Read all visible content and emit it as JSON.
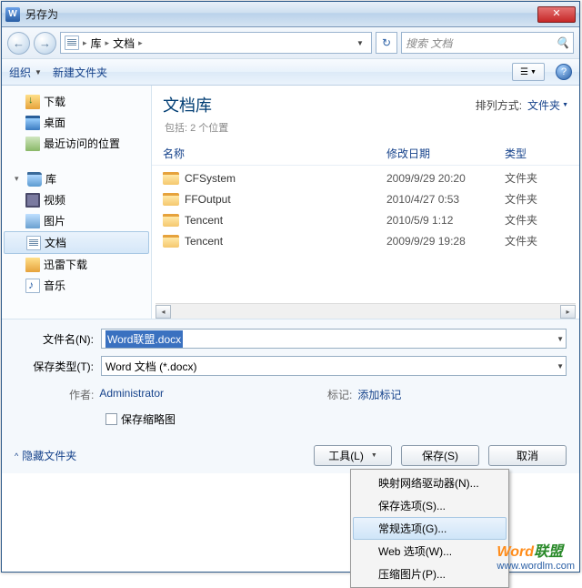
{
  "window": {
    "title": "另存为",
    "close": "✕"
  },
  "nav": {
    "back": "←",
    "forward": "→",
    "crumbs": [
      "库",
      "文档"
    ],
    "refresh": "↻",
    "search_placeholder": "搜索 文档"
  },
  "toolbar": {
    "organize": "组织",
    "newfolder": "新建文件夹",
    "help": "?"
  },
  "sidebar": {
    "items": [
      {
        "label": "下载",
        "icon": "ic-dl"
      },
      {
        "label": "桌面",
        "icon": "ic-desktop"
      },
      {
        "label": "最近访问的位置",
        "icon": "ic-recent"
      }
    ],
    "lib_header": "库",
    "lib_items": [
      {
        "label": "视频",
        "icon": "ic-video"
      },
      {
        "label": "图片",
        "icon": "ic-pic"
      },
      {
        "label": "文档",
        "icon": "ic-doc",
        "selected": true
      },
      {
        "label": "迅雷下载",
        "icon": "ic-thunder"
      },
      {
        "label": "音乐",
        "icon": "ic-music"
      }
    ]
  },
  "main": {
    "lib_title": "文档库",
    "lib_sub": "包括: 2 个位置",
    "arrange_label": "排列方式:",
    "arrange_value": "文件夹",
    "cols": {
      "name": "名称",
      "date": "修改日期",
      "type": "类型"
    },
    "rows": [
      {
        "name": "CFSystem",
        "date": "2009/9/29 20:20",
        "type": "文件夹"
      },
      {
        "name": "FFOutput",
        "date": "2010/4/27 0:53",
        "type": "文件夹"
      },
      {
        "name": "Tencent",
        "date": "2010/5/9 1:12",
        "type": "文件夹"
      },
      {
        "name": "Tencent",
        "date": "2009/9/29 19:28",
        "type": "文件夹"
      }
    ]
  },
  "form": {
    "filename_label": "文件名(N):",
    "filename_value": "Word联盟.docx",
    "savetype_label": "保存类型(T):",
    "savetype_value": "Word 文档 (*.docx)",
    "author_label": "作者:",
    "author_value": "Administrator",
    "tags_label": "标记:",
    "tags_value": "添加标记",
    "thumb_label": "保存缩略图"
  },
  "footer": {
    "hide_folders": "隐藏文件夹",
    "tools": "工具(L)",
    "save": "保存(S)",
    "cancel": "取消"
  },
  "menu": {
    "items": [
      "映射网络驱动器(N)...",
      "保存选项(S)...",
      "常规选项(G)...",
      "Web 选项(W)...",
      "压缩图片(P)..."
    ],
    "hover_index": 2
  },
  "watermark": {
    "brand1": "Word",
    "brand2": "联盟",
    "url": "www.wordlm.com"
  }
}
